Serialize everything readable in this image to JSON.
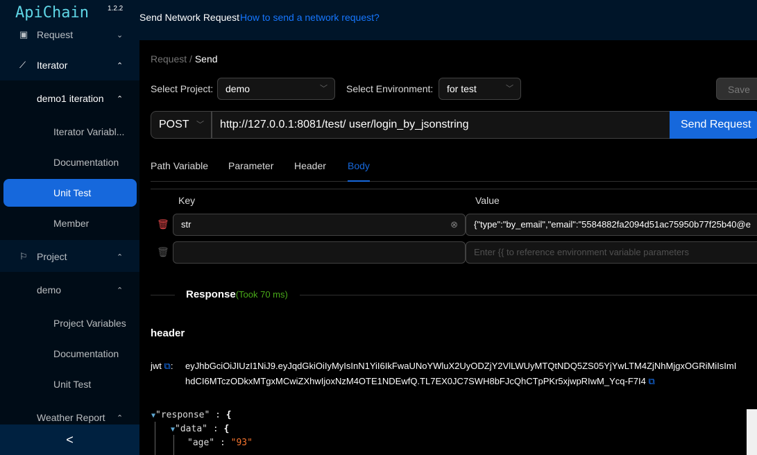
{
  "app": {
    "name": "ApiChain",
    "version": "1.2.2"
  },
  "header": {
    "title": "Send Network Request",
    "help_link": "How to send a network request?"
  },
  "sidebar": {
    "items": [
      {
        "label": "Request",
        "icon": "request-icon"
      },
      {
        "label": "Iterator",
        "icon": "chart-line-icon"
      },
      {
        "label": "demo1 iteration"
      },
      {
        "label": "Iterator Variabl..."
      },
      {
        "label": "Documentation"
      },
      {
        "label": "Unit Test"
      },
      {
        "label": "Member"
      },
      {
        "label": "Project",
        "icon": "flag-icon"
      },
      {
        "label": "demo"
      },
      {
        "label": "Project Variables"
      },
      {
        "label": "Documentation"
      },
      {
        "label": "Unit Test"
      },
      {
        "label": "Weather Report"
      }
    ],
    "collapse": "<"
  },
  "breadcrumb": {
    "parent": "Request",
    "sep": "/",
    "current": "Send"
  },
  "form": {
    "project_label": "Select Project:",
    "project": "demo",
    "env_label": "Select Environment:",
    "env": "for test",
    "save": "Save",
    "method": "POST",
    "url": "http://127.0.0.1:8081/test/ user/login_by_jsonstring",
    "send": "Send Request"
  },
  "tabs": [
    "Path Variable",
    "Parameter",
    "Header",
    "Body"
  ],
  "body_table": {
    "key_header": "Key",
    "value_header": "Value",
    "rows": [
      {
        "key": "str",
        "value": "{\"type\":\"by_email\",\"email\":\"5584882fa2094d51ac75950b77f25b40@e"
      }
    ],
    "value_placeholder": "Enter {{ to reference environment variable parameters"
  },
  "response": {
    "title": "Response",
    "took": "(Took 70 ms)",
    "header_title": "header",
    "jwt_key": "jwt",
    "jwt_line1": "eyJhbGciOiJIUzI1NiJ9.eyJqdGkiOiIyMyIsInN1YiI6IkFwaUNoYWluX2UyODZjY2VlLWUyMTQtNDQ5ZS05YjYwLTM4ZjNhMjgxOGRiMiIsImI",
    "jwt_line2": "hdCI6MTczODkxMTgxMCwiZXhwIjoxNzM4OTE1NDEwfQ.TL7EX0JC7SWH8bFJcQhCTpPKr5xjwpRIwM_Ycq-F7I4",
    "tree": {
      "k1": "\"response\"",
      "k2": "\"data\"",
      "k3": "\"age\"",
      "v3": "\"93\"",
      "brace": "{",
      "colon": ":"
    }
  }
}
